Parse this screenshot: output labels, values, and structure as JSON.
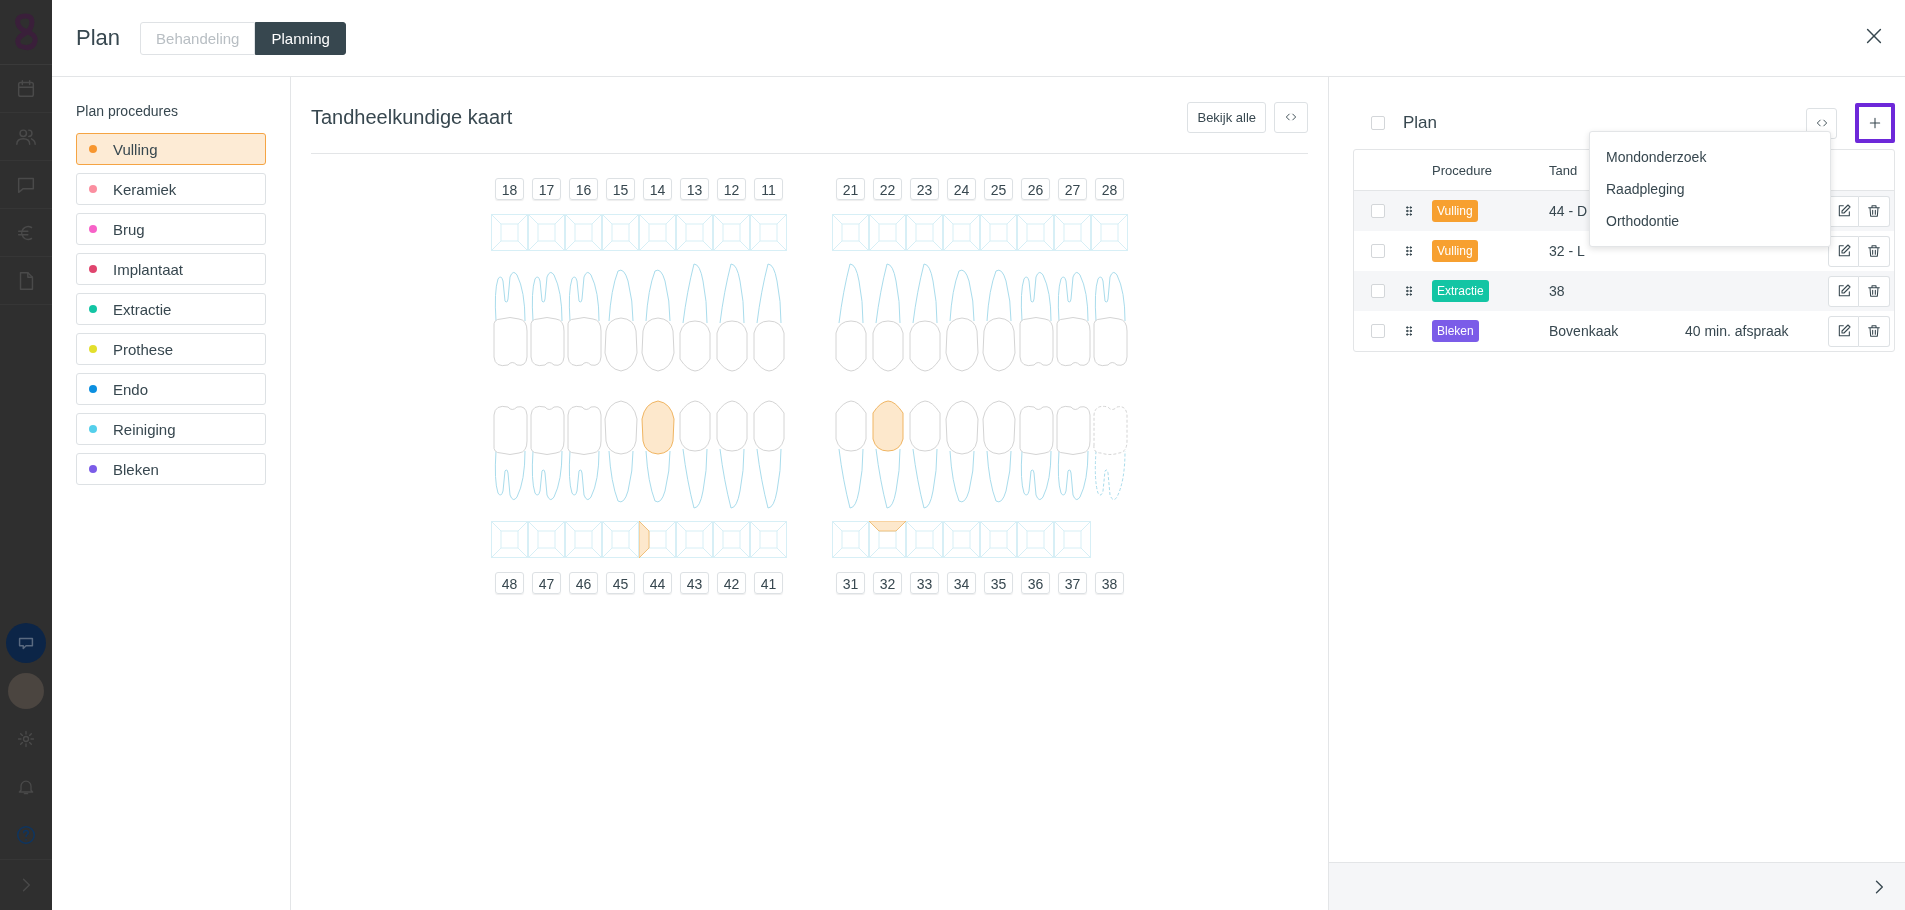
{
  "header": {
    "title": "Plan",
    "tabs": [
      {
        "label": "Behandeling",
        "selected": false
      },
      {
        "label": "Planning",
        "selected": true
      }
    ]
  },
  "procedures": {
    "title": "Plan procedures",
    "items": [
      {
        "label": "Vulling",
        "color": "#f7962f",
        "selected": true
      },
      {
        "label": "Keramiek",
        "color": "#fb8fa0",
        "selected": false
      },
      {
        "label": "Brug",
        "color": "#f762c8",
        "selected": false
      },
      {
        "label": "Implantaat",
        "color": "#e0456e",
        "selected": false
      },
      {
        "label": "Extractie",
        "color": "#13c5a4",
        "selected": false
      },
      {
        "label": "Prothese",
        "color": "#e3df2d",
        "selected": false
      },
      {
        "label": "Endo",
        "color": "#0b8fe0",
        "selected": false
      },
      {
        "label": "Reiniging",
        "color": "#54cfeb",
        "selected": false
      },
      {
        "label": "Bleken",
        "color": "#7b5ce8",
        "selected": false
      }
    ]
  },
  "chart": {
    "title": "Tandheelkundige kaart",
    "view_all_button": "Bekijk alle",
    "upper_right": [
      {
        "number": "18",
        "filled": false,
        "extracted": false
      },
      {
        "number": "17",
        "filled": false,
        "extracted": false
      },
      {
        "number": "16",
        "filled": false,
        "extracted": false
      },
      {
        "number": "15",
        "filled": false,
        "extracted": false
      },
      {
        "number": "14",
        "filled": false,
        "extracted": false
      },
      {
        "number": "13",
        "filled": false,
        "extracted": false
      },
      {
        "number": "12",
        "filled": false,
        "extracted": false
      },
      {
        "number": "11",
        "filled": false,
        "extracted": false
      }
    ],
    "upper_left": [
      {
        "number": "21",
        "filled": false,
        "extracted": false
      },
      {
        "number": "22",
        "filled": false,
        "extracted": false
      },
      {
        "number": "23",
        "filled": false,
        "extracted": false
      },
      {
        "number": "24",
        "filled": false,
        "extracted": false
      },
      {
        "number": "25",
        "filled": false,
        "extracted": false
      },
      {
        "number": "26",
        "filled": false,
        "extracted": false
      },
      {
        "number": "27",
        "filled": false,
        "extracted": false
      },
      {
        "number": "28",
        "filled": false,
        "extracted": false
      }
    ],
    "lower_right": [
      {
        "number": "48",
        "filled": false,
        "extracted": false
      },
      {
        "number": "47",
        "filled": false,
        "extracted": false
      },
      {
        "number": "46",
        "filled": false,
        "extracted": false
      },
      {
        "number": "45",
        "filled": false,
        "extracted": false
      },
      {
        "number": "44",
        "filled": true,
        "extracted": false,
        "distal": true,
        "lingual": false
      },
      {
        "number": "43",
        "filled": false,
        "extracted": false
      },
      {
        "number": "42",
        "filled": false,
        "extracted": false
      },
      {
        "number": "41",
        "filled": false,
        "extracted": false
      }
    ],
    "lower_left": [
      {
        "number": "31",
        "filled": false,
        "extracted": false
      },
      {
        "number": "32",
        "filled": true,
        "extracted": false,
        "distal": false,
        "lingual": true
      },
      {
        "number": "33",
        "filled": false,
        "extracted": false
      },
      {
        "number": "34",
        "filled": false,
        "extracted": false
      },
      {
        "number": "35",
        "filled": false,
        "extracted": false
      },
      {
        "number": "36",
        "filled": false,
        "extracted": false
      },
      {
        "number": "37",
        "filled": false,
        "extracted": false
      },
      {
        "number": "38",
        "filled": false,
        "extracted": true
      }
    ]
  },
  "plan": {
    "title": "Plan",
    "checked": false,
    "columns": [
      "Procedure",
      "Tand"
    ],
    "rows": [
      {
        "checked": false,
        "procedure": "Vulling",
        "color": "#f7a030",
        "tooth": "44 - D"
      },
      {
        "checked": false,
        "procedure": "Vulling",
        "color": "#f7a030",
        "tooth": "32 - L"
      },
      {
        "checked": false,
        "procedure": "Extractie",
        "color": "#13c5a4",
        "tooth": "38"
      },
      {
        "checked": false,
        "procedure": "Bleken",
        "color": "#7b5ce8",
        "tooth": "Bovenkaak",
        "column_3": "40 min. afspraak"
      }
    ],
    "menu": [
      "Mondonderzoek",
      "Raadpleging",
      "Orthodontie"
    ]
  }
}
